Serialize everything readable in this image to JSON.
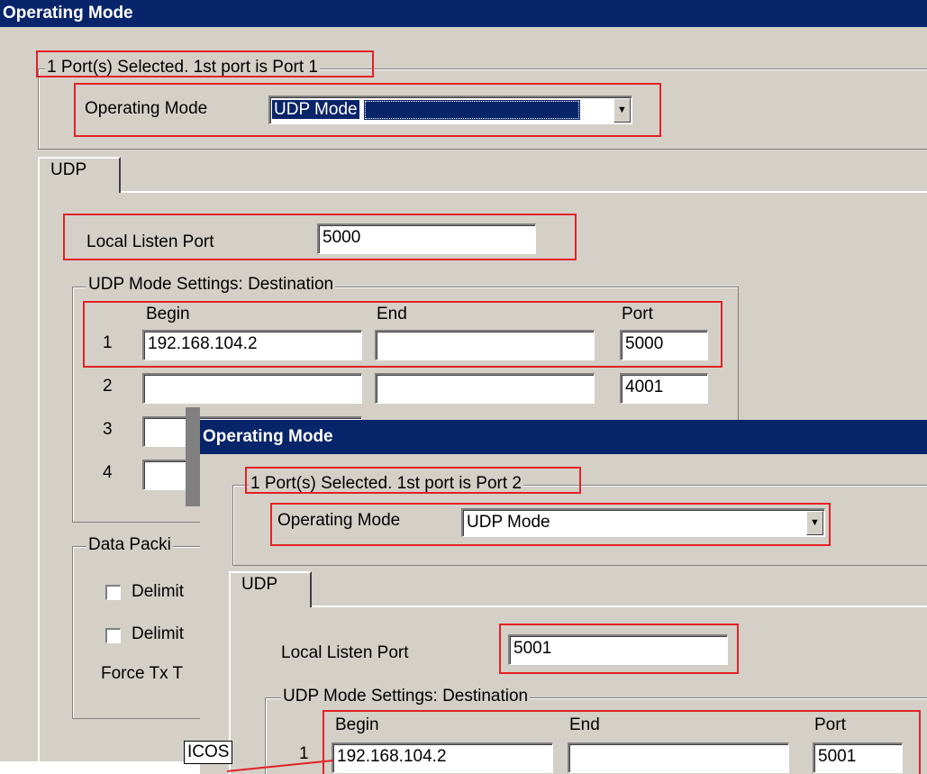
{
  "back_window": {
    "title": "Operating Mode",
    "ports_group_label": "1 Port(s) Selected. 1st port is Port 1",
    "operating_mode_label": "Operating Mode",
    "operating_mode_value": "UDP Mode",
    "tab_label": "UDP",
    "local_listen_port_label": "Local Listen Port",
    "local_listen_port_value": "5000",
    "destination_group_label": "UDP Mode Settings: Destination",
    "columns": {
      "begin": "Begin",
      "end": "End",
      "port": "Port"
    },
    "rows": [
      {
        "index": "1",
        "begin": "192.168.104.2",
        "end": "",
        "port": "5000"
      },
      {
        "index": "2",
        "begin": "",
        "end": "",
        "port": "4001"
      },
      {
        "index": "3",
        "begin": "",
        "end": "",
        "port": ""
      },
      {
        "index": "4",
        "begin": "",
        "end": "",
        "port": ""
      }
    ],
    "data_packing_label": "Data Packi",
    "delimiter1_label": "Delimit",
    "delimiter2_label": "Delimit",
    "force_tx_label": "Force Tx T"
  },
  "front_window": {
    "title": "Operating Mode",
    "ports_group_label": "1 Port(s) Selected. 1st port is Port 2",
    "operating_mode_label": "Operating Mode",
    "operating_mode_value": "UDP Mode",
    "tab_label": "UDP",
    "local_listen_port_label": "Local Listen Port",
    "local_listen_port_value": "5001",
    "destination_group_label": "UDP Mode Settings: Destination",
    "columns": {
      "begin": "Begin",
      "end": "End",
      "port": "Port"
    },
    "rows": [
      {
        "index": "1",
        "begin": "192.168.104.2",
        "end": "",
        "port": "5001"
      }
    ]
  },
  "overlay_label": "ICOS",
  "colors": {
    "title_bar": "#08246b",
    "face": "#d4d0c8",
    "highlight_box": "#e32125",
    "selection": "#0a246a"
  }
}
